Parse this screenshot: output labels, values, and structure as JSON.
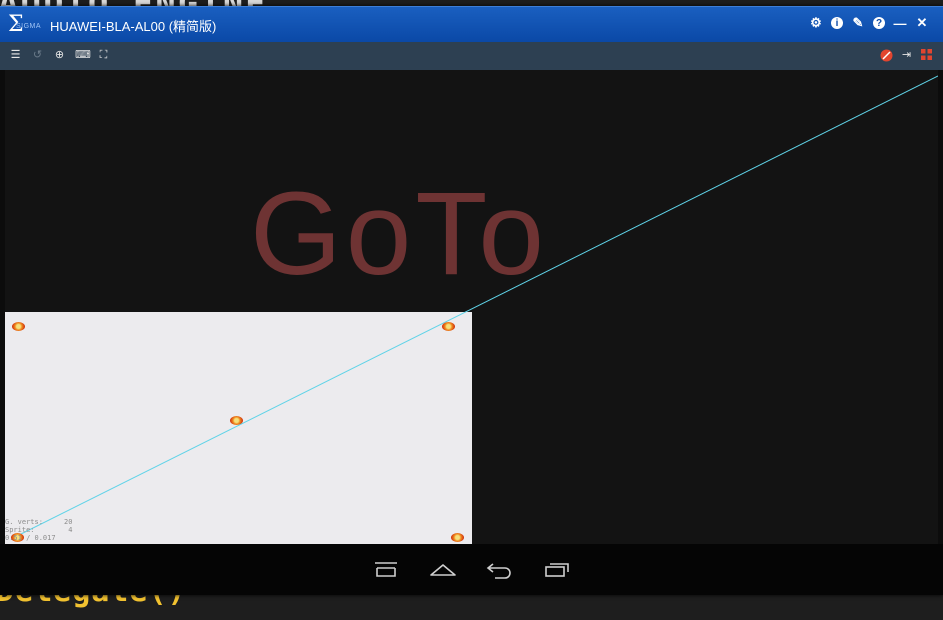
{
  "background": {
    "code_top": "AUDIO_ENGINE",
    "code_bottom": "Delegate()"
  },
  "window": {
    "logo_text": "SIGMA",
    "title": "HUAWEI-BLA-AL00 (精简版)",
    "title_icons": [
      "gear-icon",
      "info-icon",
      "pin-icon",
      "help-icon",
      "minimize-icon",
      "close-icon"
    ],
    "toolbar_left_icons": [
      "list-icon",
      "undo-icon",
      "zoom-icon",
      "keyboard-icon",
      "fullscreen-icon"
    ],
    "toolbar_right_icons": [
      "mute-icon",
      "exit-icon",
      "grid-icon"
    ]
  },
  "device_screen": {
    "overlay_text": "GoTo",
    "stats_lines": [
      "G. verts:     20",
      "Sprite:        4",
      "0.51 / 0.017"
    ]
  },
  "navbar": {
    "buttons": [
      "menu-icon",
      "home-icon",
      "back-icon",
      "recent-apps-icon"
    ]
  },
  "colors": {
    "titlebar": "#0a48a6",
    "toolbar": "#2d4052",
    "overlay_text": "#6e3333",
    "trace_line": "#5fd3e8",
    "panel": "#ecebee"
  }
}
